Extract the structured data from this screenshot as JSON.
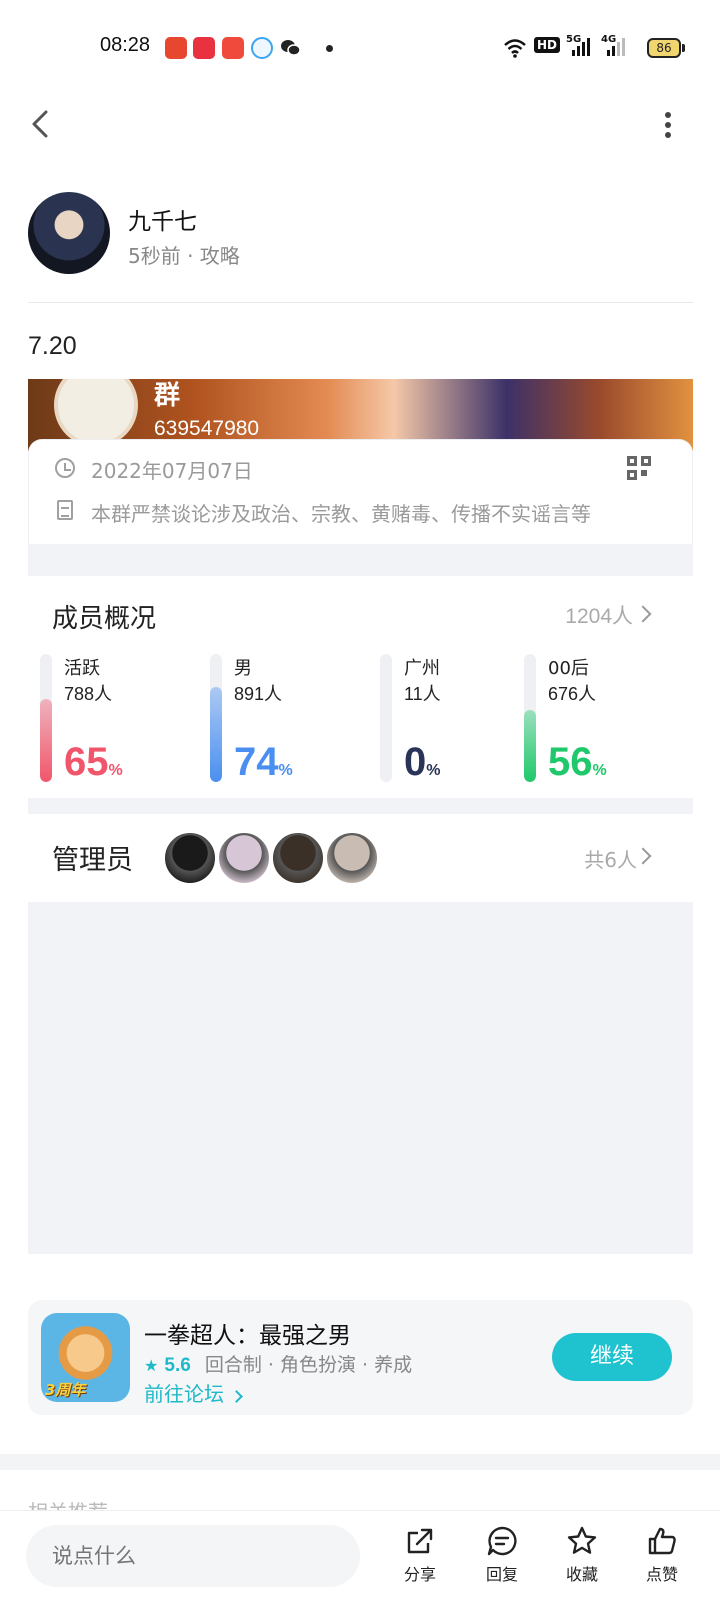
{
  "status_bar": {
    "time": "08:28",
    "notification_icons": [
      "toutiao-app-icon",
      "xiaohongshu-app-icon",
      "video-app-icon",
      "browser-app-icon",
      "wechat-icon"
    ],
    "network": [
      "wifi-icon",
      "HD",
      "5G",
      "4G"
    ],
    "battery": "86"
  },
  "post": {
    "author_name": "九千七",
    "author_meta": "5秒前 · 攻略",
    "title": "7.20"
  },
  "group_card": {
    "banner_title": "群",
    "group_id": "639547980",
    "date": "2022年07月07日",
    "rules": "本群严禁谈论涉及政治、宗教、黄赌毒、传播不实谣言等"
  },
  "members": {
    "title": "成员概况",
    "total": "1204人",
    "stats": [
      {
        "label": "活跃",
        "count": "788人",
        "percent": 65,
        "pct_text": "65",
        "color": "#f0566b"
      },
      {
        "label": "男",
        "count": "891人",
        "percent": 74,
        "pct_text": "74",
        "color": "#4a8ff0"
      },
      {
        "label": "广州",
        "count": "11人",
        "percent": 0,
        "pct_text": "0",
        "color": "#2a3458"
      },
      {
        "label": "00后",
        "count": "676人",
        "percent": 56,
        "pct_text": "56",
        "color": "#1fc86a"
      }
    ],
    "pct_sign": "%"
  },
  "admins": {
    "title": "管理员",
    "total": "共6人",
    "avatar_colors": [
      "#1a1a1a",
      "#d7c6d6",
      "#3b3028",
      "#c9bdb3"
    ]
  },
  "game": {
    "name": "一拳超人：最强之男",
    "score": "5.6",
    "tags": "回合制 · 角色扮演 · 养成",
    "forum_link": "前往论坛",
    "icon_badge": "3周年",
    "continue_label": "继续"
  },
  "related_label": "相关推荐",
  "bottom_bar": {
    "comment_placeholder": "说点什么",
    "share": "分享",
    "reply": "回复",
    "favorite": "收藏",
    "like": "点赞"
  }
}
